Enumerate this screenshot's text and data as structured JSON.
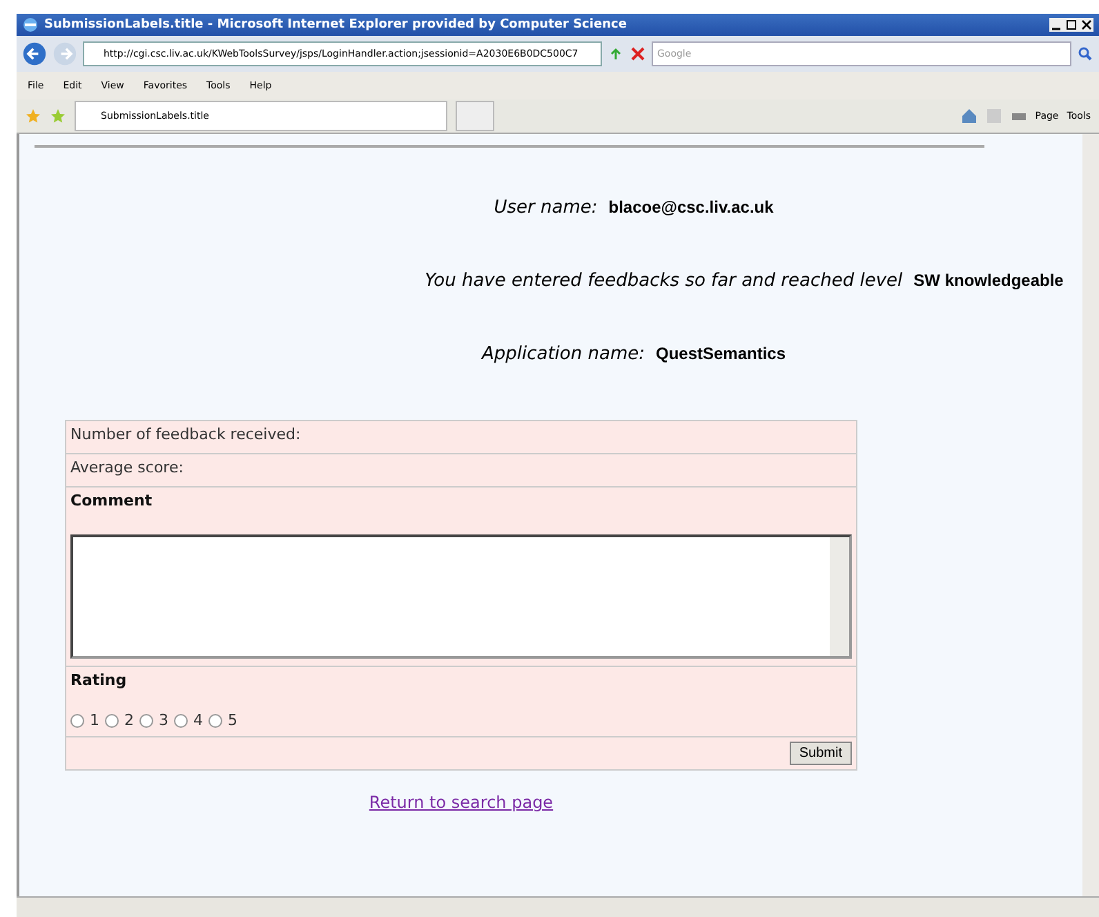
{
  "window": {
    "title": "SubmissionLabels.title - Microsoft Internet Explorer provided by Computer Science"
  },
  "address_bar": {
    "url": "http://cgi.csc.liv.ac.uk/KWebToolsSurvey/jsps/LoginHandler.action;jsessionid=A2030E6B0DC500C7",
    "search_placeholder": "Google"
  },
  "menu": [
    "File",
    "Edit",
    "View",
    "Favorites",
    "Tools",
    "Help"
  ],
  "tab": {
    "title": "SubmissionLabels.title"
  },
  "command_bar": [
    "Page",
    "Tools"
  ],
  "info": [
    {
      "label": "User name:",
      "value": "blacoe@csc.liv.ac.uk"
    },
    {
      "label": "You have entered feedbacks so far and reached level",
      "value": "SW knowledgeable"
    },
    {
      "label": "Application name:",
      "value": "QuestSemantics"
    }
  ],
  "form": {
    "feedback_count_label": "Number of feedback received:",
    "average_label": "Average score:",
    "comment_label": "Comment",
    "rating_label": "Rating",
    "ratings": [
      {
        "label": "1",
        "selected": false
      },
      {
        "label": "2",
        "selected": false
      },
      {
        "label": "3",
        "selected": false
      },
      {
        "label": "4",
        "selected": false
      },
      {
        "label": "5",
        "selected": false
      }
    ],
    "submit": "Submit"
  },
  "link": "Return to search page"
}
